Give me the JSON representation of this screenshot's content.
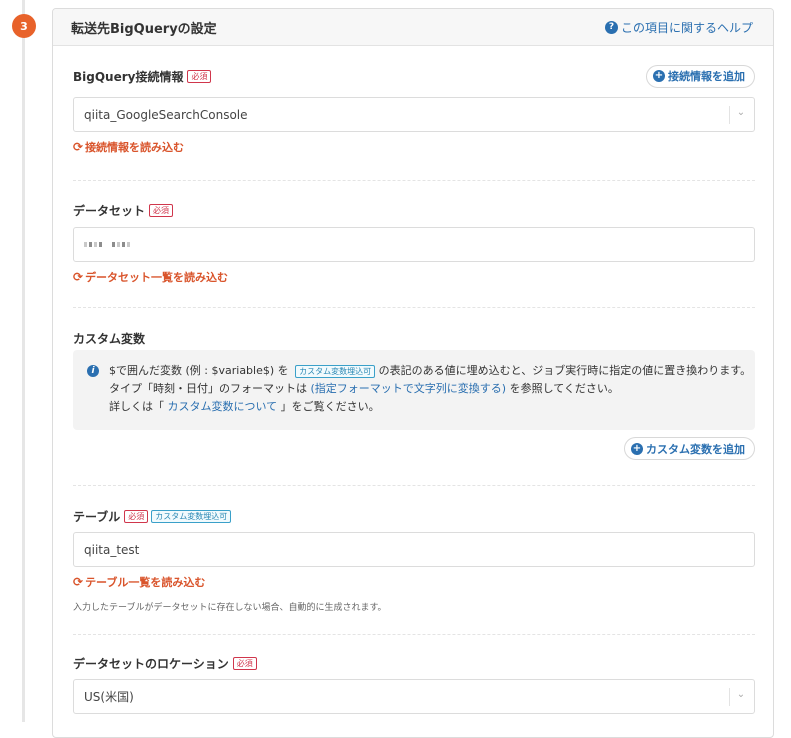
{
  "step": {
    "number": "3"
  },
  "header": {
    "title": "転送先BigQueryの設定",
    "help_label": "この項目に関するヘルプ"
  },
  "connection": {
    "label": "BigQuery接続情報",
    "required": "必須",
    "add_label": "接続情報を追加",
    "value": "qiita_GoogleSearchConsole",
    "reload_label": "接続情報を読み込む"
  },
  "dataset": {
    "label": "データセット",
    "required": "必須",
    "reload_label": "データセット一覧を読み込む"
  },
  "custom_vars": {
    "label": "カスタム変数",
    "info_line1_a": "$で囲んだ変数 (例 : $variable$) を",
    "info_tag": "カスタム変数埋込可",
    "info_line1_b": "の表記のある値に埋め込むと、ジョブ実行時に指定の値に置き換わります。",
    "info_line2_a": "タイプ「時刻・日付」のフォーマットは",
    "info_line2_link": "(指定フォーマットで文字列に変換する)",
    "info_line2_b": "を参照してください。",
    "info_line3_a": "詳しくは「",
    "info_line3_link": "カスタム変数について",
    "info_line3_b": "」をご覧ください。",
    "add_label": "カスタム変数を追加"
  },
  "table": {
    "label": "テーブル",
    "required": "必須",
    "tag": "カスタム変数埋込可",
    "value": "qiita_test",
    "reload_label": "テーブル一覧を読み込む",
    "note": "入力したテーブルがデータセットに存在しない場合、自動的に生成されます。"
  },
  "location": {
    "label": "データセットのロケーション",
    "required": "必須",
    "value": "US(米国)"
  },
  "colors": {
    "accent": "#2a6fb0",
    "step_badge": "#e8622a",
    "reload": "#d9542b",
    "required": "#d0364c"
  }
}
